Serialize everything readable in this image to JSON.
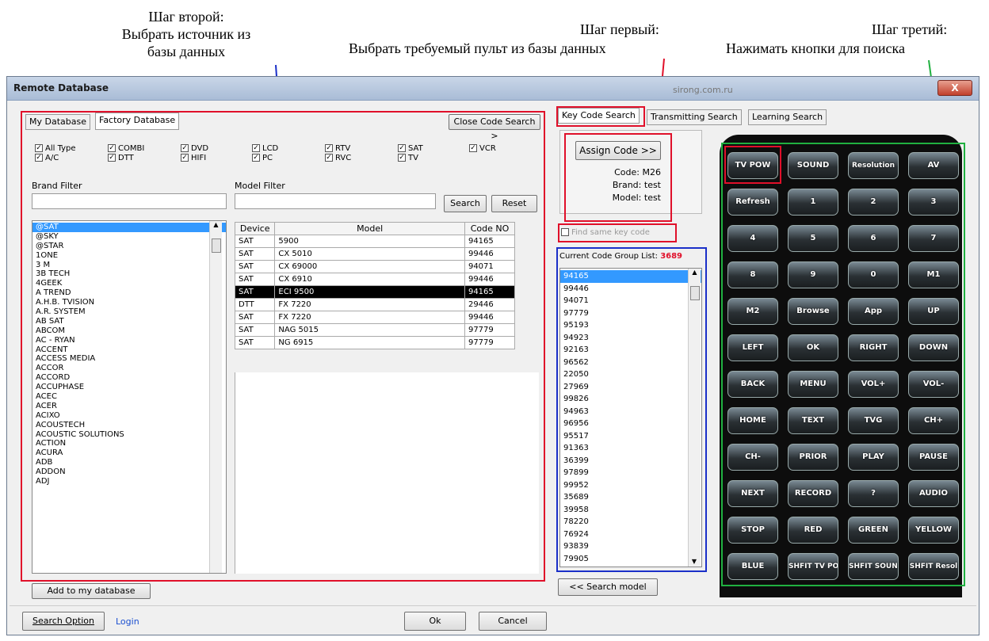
{
  "annotations": {
    "step2_line1": "Шаг второй:",
    "step2_line2": "Выбрать источник из",
    "step2_line3": "базы данных",
    "step1_line1": "Шаг первый:",
    "step1_line2": "Выбрать требуемый пульт из базы данных",
    "step3_line1": "Шаг третий:",
    "step3_line2": "Нажимать кнопки для поиска"
  },
  "window": {
    "title": "Remote Database",
    "close_label": "X",
    "watermark": "sirong.com.ru"
  },
  "left": {
    "tabs": [
      "My Database",
      "Factory Database"
    ],
    "close_code_search": "Close Code Search >",
    "types": [
      [
        "All Type",
        "COMBI",
        "DVD",
        "LCD",
        "RTV",
        "SAT",
        "VCR"
      ],
      [
        "A/C",
        "DTT",
        "HIFI",
        "PC",
        "RVC",
        "TV"
      ]
    ],
    "brand_filter_label": "Brand Filter",
    "model_filter_label": "Model Filter",
    "search_label": "Search",
    "reset_label": "Reset",
    "brands": [
      "@SAT",
      "@SKY",
      "@STAR",
      "1ONE",
      "3 M",
      "3B TECH",
      "4GEEK",
      "A TREND",
      "A.H.B. TVISION",
      "A.R. SYSTEM",
      "AB SAT",
      "ABCOM",
      "AC - RYAN",
      "ACCENT",
      "ACCESS MEDIA",
      "ACCOR",
      "ACCORD",
      "ACCUPHASE",
      "ACEC",
      "ACER",
      "ACIXO",
      "ACOUSTECH",
      "ACOUSTIC SOLUTIONS",
      "ACTION",
      "ACURA",
      "ADB",
      "ADDON",
      "ADJ"
    ],
    "table": {
      "headers": [
        "Device",
        "Model",
        "Code NO"
      ],
      "rows": [
        [
          "SAT",
          "5900",
          "94165"
        ],
        [
          "SAT",
          "CX 5010",
          "99446"
        ],
        [
          "SAT",
          "CX 69000",
          "94071"
        ],
        [
          "SAT",
          "CX 6910",
          "99446"
        ],
        [
          "SAT",
          "ECI 9500",
          "94165"
        ],
        [
          "DTT",
          "FX 7220",
          "29446"
        ],
        [
          "SAT",
          "FX 7220",
          "99446"
        ],
        [
          "SAT",
          "NAG 5015",
          "97779"
        ],
        [
          "SAT",
          "NG 6915",
          "97779"
        ]
      ]
    },
    "add_to_db": "Add to my database"
  },
  "middle": {
    "tabs": [
      "Key Code Search",
      "Transmitting Search",
      "Learning Search"
    ],
    "assign_code": "Assign Code >>",
    "code_label": "Code:",
    "code_value": "M26",
    "brand_label": "Brand:",
    "brand_value": "test",
    "model_label": "Model:",
    "model_value": "test",
    "find_same": "Find same key code",
    "group_label": "Current Code Group List:",
    "group_count": "3689",
    "codes": [
      "94165",
      "99446",
      "94071",
      "97779",
      "95193",
      "94923",
      "92163",
      "96562",
      "22050",
      "27969",
      "99826",
      "94963",
      "96956",
      "95517",
      "91363",
      "36399",
      "97899",
      "99952",
      "35689",
      "39958",
      "78220",
      "76924",
      "93839",
      "79905"
    ],
    "search_model": "<< Search model"
  },
  "remote": {
    "buttons": [
      "TV POW",
      "SOUND",
      "Resolution",
      "AV",
      "Refresh",
      "1",
      "2",
      "3",
      "4",
      "5",
      "6",
      "7",
      "8",
      "9",
      "0",
      "M1",
      "M2",
      "Browse",
      "App",
      "UP",
      "LEFT",
      "OK",
      "RIGHT",
      "DOWN",
      "BACK",
      "MENU",
      "VOL+",
      "VOL-",
      "HOME",
      "TEXT",
      "TVG",
      "CH+",
      "CH-",
      "PRIOR",
      "PLAY",
      "PAUSE",
      "NEXT",
      "RECORD",
      "?",
      "AUDIO",
      "STOP",
      "RED",
      "GREEN",
      "YELLOW",
      "BLUE",
      "SHFIT TV POW",
      "SHFIT SOUND",
      "SHFIT Resol"
    ]
  },
  "bottom": {
    "search_option": "Search Option",
    "login": "Login",
    "ok": "Ok",
    "cancel": "Cancel"
  },
  "colors": {
    "highlight_red": "#e0102a",
    "highlight_blue": "#1a2fc8",
    "highlight_green": "#20b040",
    "selection": "#3399ff"
  }
}
